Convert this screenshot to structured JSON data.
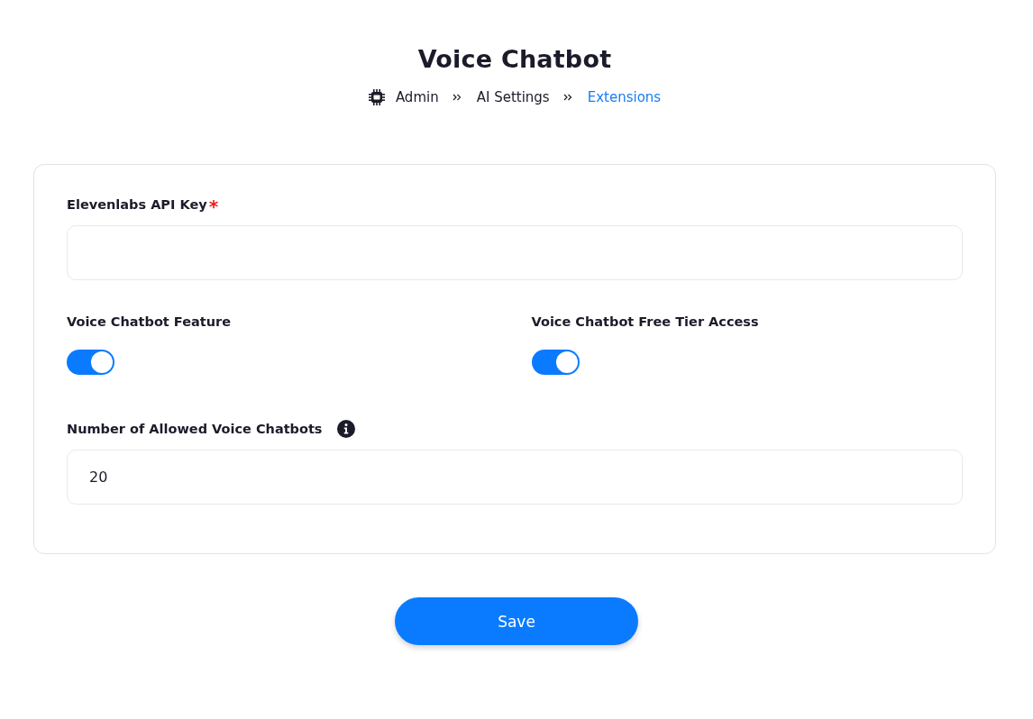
{
  "header": {
    "title": "Voice Chatbot",
    "breadcrumb": [
      {
        "label": "Admin",
        "current": false
      },
      {
        "label": "AI Settings",
        "current": false
      },
      {
        "label": "Extensions",
        "current": true
      }
    ]
  },
  "form": {
    "fields": [
      {
        "kind": "input",
        "label": "Elevenlabs API Key",
        "required_mark": "*"
      },
      {
        "kind": "toggle",
        "label": "Voice Chatbot Feature",
        "on": true
      },
      {
        "kind": "toggle",
        "label": "Voice Chatbot Free Tier Access",
        "on": true
      },
      {
        "kind": "input",
        "label": "Number of Allowed Voice Chatbots",
        "info": true,
        "value": "20"
      }
    ]
  },
  "save_button": {
    "label": "Save"
  }
}
